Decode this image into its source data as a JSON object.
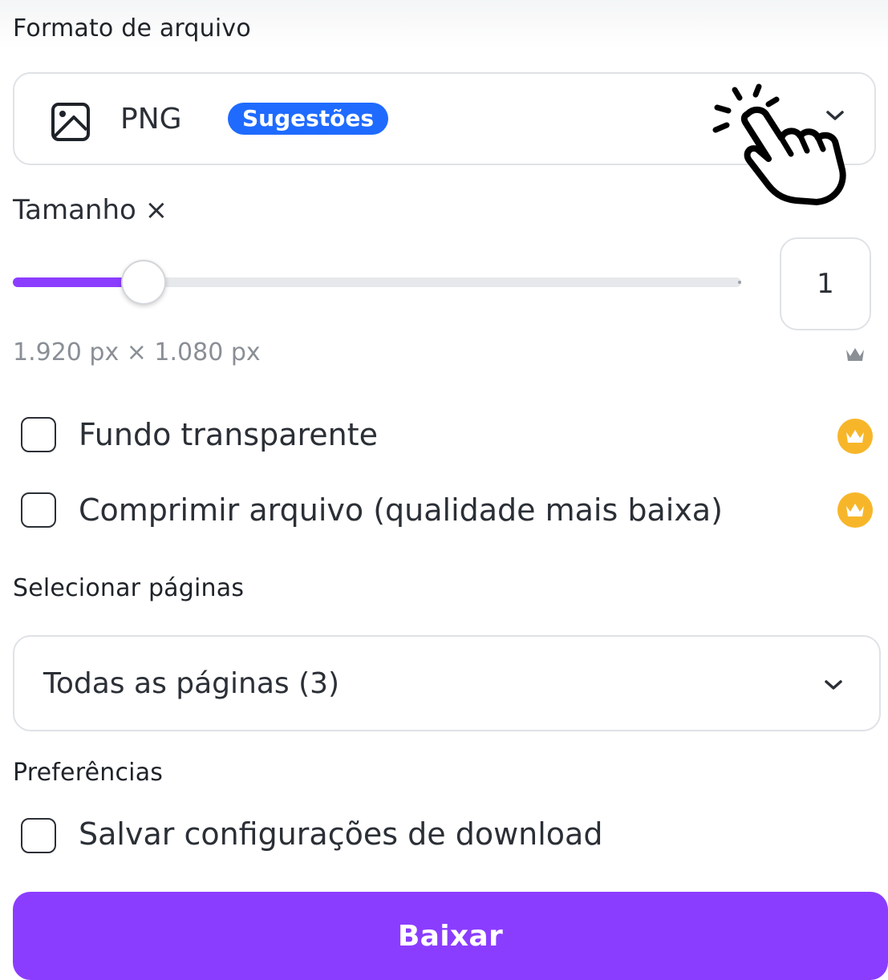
{
  "format": {
    "label": "Formato de arquivo",
    "selected": "PNG",
    "badge": "Sugestões",
    "icon": "image-icon"
  },
  "size": {
    "label": "Tamanho ×",
    "slider_fraction": 0.18,
    "value": "1",
    "dimensions": "1.920 px × 1.080 px"
  },
  "options": [
    {
      "label": "Fundo transparente",
      "checked": false,
      "pro": true
    },
    {
      "label": "Comprimir arquivo (qualidade mais baixa)",
      "checked": false,
      "pro": true
    }
  ],
  "pages": {
    "label": "Selecionar páginas",
    "selected": "Todas as páginas (3)"
  },
  "preferences": {
    "label": "Preferências",
    "save_label": "Salvar configurações de download",
    "checked": false
  },
  "download_button": "Baixar",
  "colors": {
    "accent": "#8b3dff",
    "badge": "#1f6bff",
    "pro_crown": "#f7b62a"
  }
}
